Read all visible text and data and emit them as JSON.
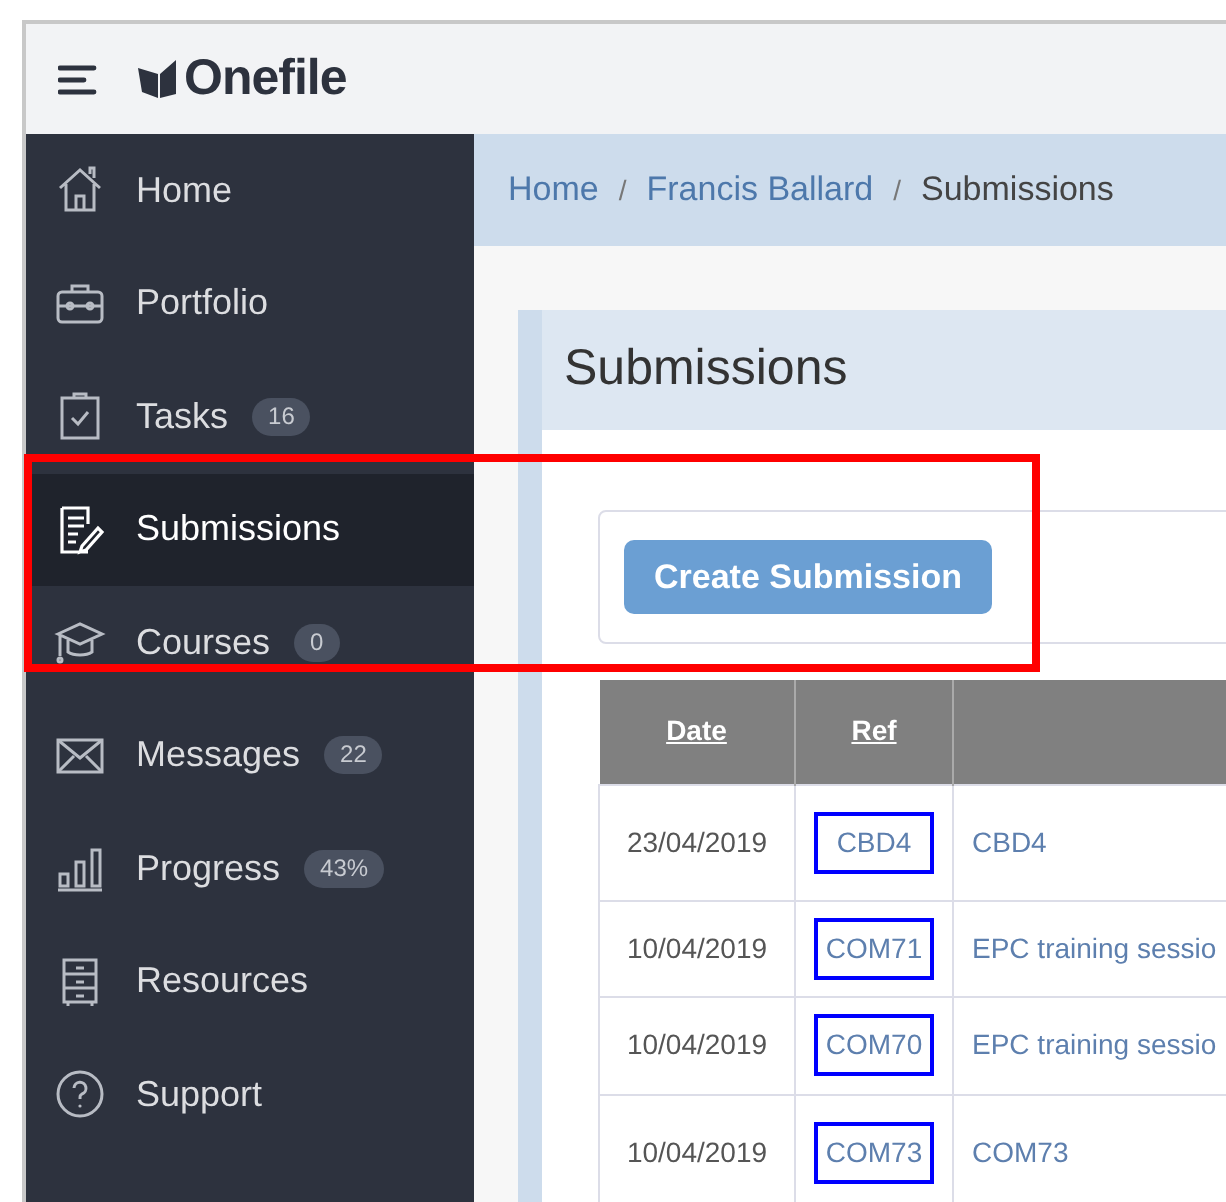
{
  "header": {
    "logo": "Onefile"
  },
  "sidebar": {
    "items": [
      {
        "label": "Home",
        "selected": false
      },
      {
        "label": "Portfolio",
        "selected": false
      },
      {
        "label": "Tasks",
        "badge": "16",
        "selected": false
      },
      {
        "label": "Submissions",
        "selected": true
      },
      {
        "label": "Courses",
        "badge": "0",
        "selected": false
      },
      {
        "label": "Messages",
        "badge": "22",
        "selected": false
      },
      {
        "label": "Progress",
        "badge": "43%",
        "selected": false
      },
      {
        "label": "Resources",
        "selected": false
      },
      {
        "label": "Support",
        "selected": false
      }
    ]
  },
  "breadcrumb": {
    "separator": "/",
    "items": [
      {
        "label": "Home",
        "kind": "link"
      },
      {
        "label": "Francis Ballard",
        "kind": "link"
      },
      {
        "label": "Submissions",
        "kind": "current"
      }
    ]
  },
  "panel": {
    "title": "Submissions",
    "button": "Create Submission"
  },
  "table": {
    "columns": [
      "Date",
      "Ref"
    ],
    "rows": [
      {
        "date": "23/04/2019",
        "ref": "CBD4",
        "outlined": true,
        "description": "CBD4"
      },
      {
        "date": "10/04/2019",
        "ref": "COM71",
        "outlined": true,
        "description": "EPC training sessio"
      },
      {
        "date": "10/04/2019",
        "ref": "COM70",
        "outlined": true,
        "description": "EPC training sessio"
      },
      {
        "date": "10/04/2019",
        "ref": "COM73",
        "outlined": true,
        "description": "COM73"
      }
    ]
  }
}
